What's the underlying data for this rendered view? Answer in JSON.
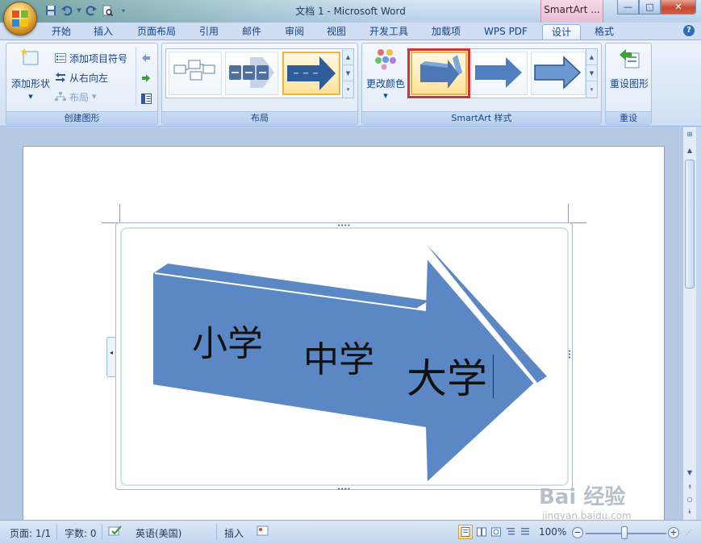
{
  "window": {
    "title": "文档 1 - Microsoft Word",
    "context_tab": "SmartArt ...",
    "buttons": {
      "minimize": "—",
      "maximize": "□",
      "close": "✕"
    }
  },
  "tabs": [
    {
      "label": "开始",
      "active": false
    },
    {
      "label": "插入",
      "active": false
    },
    {
      "label": "页面布局",
      "active": false
    },
    {
      "label": "引用",
      "active": false
    },
    {
      "label": "邮件",
      "active": false
    },
    {
      "label": "审阅",
      "active": false
    },
    {
      "label": "视图",
      "active": false
    },
    {
      "label": "开发工具",
      "active": false
    },
    {
      "label": "加载项",
      "active": false
    },
    {
      "label": "WPS PDF",
      "active": false
    },
    {
      "label": "设计",
      "active": true
    },
    {
      "label": "格式",
      "active": false
    }
  ],
  "help_label": "?",
  "ribbon": {
    "create_graphic": {
      "label": "创建图形",
      "add_shape": "添加形状",
      "add_bullet": "添加项目符号",
      "right_to_left": "从右向左",
      "layout": "布局"
    },
    "layouts": {
      "label": "布局"
    },
    "smartart_styles": {
      "label": "SmartArt 样式",
      "change_colors": "更改颜色"
    },
    "reset": {
      "label": "重设",
      "reset_graphic": "重设图形"
    }
  },
  "document": {
    "arrow_labels": [
      "小学",
      "中学",
      "大学"
    ],
    "arrow_color": "#5b87c4"
  },
  "statusbar": {
    "page": "页面: 1/1",
    "words": "字数: 0",
    "language": "英语(美国)",
    "mode": "插入",
    "zoom": "100%"
  },
  "watermark": {
    "brand": "Bai 经验",
    "url": "jingyan.baidu.com"
  },
  "colors": {
    "accent_highlight": "#d83030",
    "selected_gallery": "#f1b440",
    "ribbon_text": "#15428b"
  }
}
